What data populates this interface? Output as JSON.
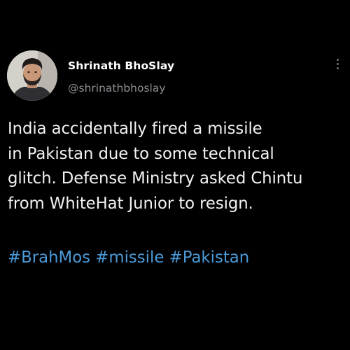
{
  "author": {
    "display_name": "Shrinath BhoSlay",
    "handle": "@shrinathbhoslay",
    "avatar_icon": "profile-photo"
  },
  "menu_icon": "more-vertical-icon",
  "tweet": {
    "lines": [
      "India accidentally fired a missile",
      "in Pakistan due to some technical",
      "glitch. Defense Ministry asked Chintu",
      "from WhiteHat Junior to resign."
    ],
    "hashtags": [
      "#BrahMos",
      "#missile",
      "#Pakistan"
    ]
  },
  "colors": {
    "background": "#000000",
    "text": "#ffffff",
    "handle": "#8b8f94",
    "hashtag": "#4a9ad8"
  }
}
